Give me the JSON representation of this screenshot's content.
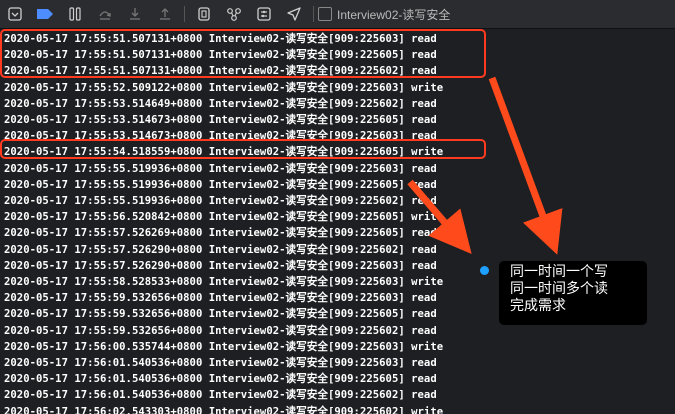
{
  "window_title": "Interview02-读写安全",
  "toolbar": {
    "buttons": [
      {
        "name": "hide-debug-area-button",
        "icon": "panel-toggle-icon"
      },
      {
        "name": "breakpoints-toggle-button",
        "icon": "breakpoint-icon"
      },
      {
        "name": "pause-button",
        "icon": "pause-icon"
      },
      {
        "name": "step-over-button",
        "icon": "step-over-icon"
      },
      {
        "name": "step-into-button",
        "icon": "step-into-icon"
      },
      {
        "name": "step-out-button",
        "icon": "step-out-icon"
      },
      {
        "name": "view-hierarchy-button",
        "icon": "view-hierarchy-icon"
      },
      {
        "name": "memory-graph-button",
        "icon": "memory-graph-icon"
      },
      {
        "name": "environment-overrides-button",
        "icon": "environment-icon"
      },
      {
        "name": "simulate-location-button",
        "icon": "location-icon"
      }
    ],
    "accent": "#4d8dff"
  },
  "log_lines": [
    "2020-05-17 17:55:51.507131+0800 Interview02-读写安全[909:225603] read",
    "2020-05-17 17:55:51.507131+0800 Interview02-读写安全[909:225605] read",
    "2020-05-17 17:55:51.507131+0800 Interview02-读写安全[909:225602] read",
    "2020-05-17 17:55:52.509122+0800 Interview02-读写安全[909:225603] write",
    "2020-05-17 17:55:53.514649+0800 Interview02-读写安全[909:225602] read",
    "2020-05-17 17:55:53.514673+0800 Interview02-读写安全[909:225605] read",
    "2020-05-17 17:55:53.514673+0800 Interview02-读写安全[909:225603] read",
    "2020-05-17 17:55:54.518559+0800 Interview02-读写安全[909:225605] write",
    "2020-05-17 17:55:55.519936+0800 Interview02-读写安全[909:225603] read",
    "2020-05-17 17:55:55.519936+0800 Interview02-读写安全[909:225605] read",
    "2020-05-17 17:55:55.519936+0800 Interview02-读写安全[909:225602] read",
    "2020-05-17 17:55:56.520842+0800 Interview02-读写安全[909:225605] write",
    "2020-05-17 17:55:57.526269+0800 Interview02-读写安全[909:225605] read",
    "2020-05-17 17:55:57.526290+0800 Interview02-读写安全[909:225602] read",
    "2020-05-17 17:55:57.526290+0800 Interview02-读写安全[909:225603] read",
    "2020-05-17 17:55:58.528533+0800 Interview02-读写安全[909:225603] write",
    "2020-05-17 17:55:59.532656+0800 Interview02-读写安全[909:225603] read",
    "2020-05-17 17:55:59.532656+0800 Interview02-读写安全[909:225605] read",
    "2020-05-17 17:55:59.532656+0800 Interview02-读写安全[909:225602] read",
    "2020-05-17 17:56:00.535744+0800 Interview02-读写安全[909:225603] write",
    "2020-05-17 17:56:01.540536+0800 Interview02-读写安全[909:225603] read",
    "2020-05-17 17:56:01.540536+0800 Interview02-读写安全[909:225605] read",
    "2020-05-17 17:56:01.540536+0800 Interview02-读写安全[909:225602] read",
    "2020-05-17 17:56:02.543303+0800 Interview02-读写安全[909:225602] write"
  ],
  "annotation": {
    "lines": [
      "同一时间一个写",
      "同一时间多个读",
      "完成需求"
    ],
    "highlight_color": "#ff3b1f",
    "arrow_color": "#ff4a1c",
    "dot_color": "#1da0ff"
  }
}
